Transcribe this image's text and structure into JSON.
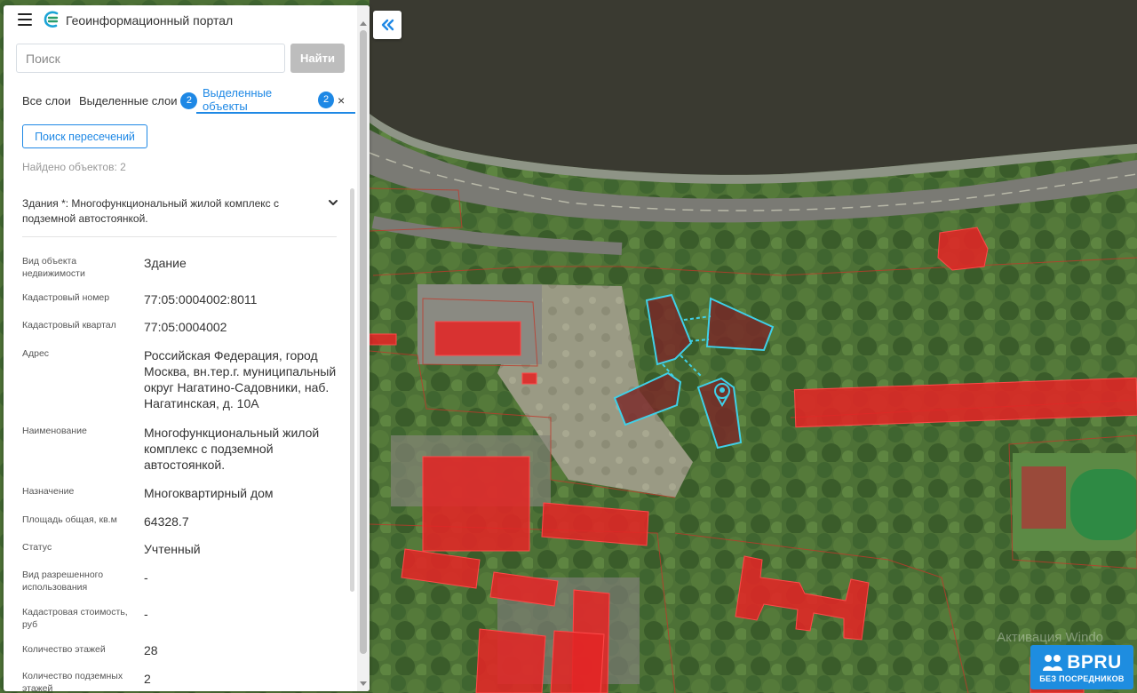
{
  "header": {
    "title": "Геоинформационный портал"
  },
  "search": {
    "placeholder": "Поиск",
    "button_label": "Найти"
  },
  "tabs": [
    {
      "label": "Все слои"
    },
    {
      "label": "Выделенные слои",
      "count": "2"
    },
    {
      "label": "Выделенные объекты",
      "count": "2",
      "active": true
    }
  ],
  "tab_close": "×",
  "intersect_button": "Поиск пересечений",
  "found_text": "Найдено объектов: 2",
  "object": {
    "title": "Здания *: Многофункциональный жилой комплекс с подземной автостоянкой."
  },
  "attributes": [
    {
      "label": "Вид объекта недвижимости",
      "value": "Здание"
    },
    {
      "label": "Кадастровый номер",
      "value": "77:05:0004002:8011"
    },
    {
      "label": "Кадастровый квартал",
      "value": "77:05:0004002"
    },
    {
      "label": "Адрес",
      "value": "Российская Федерация, город Москва, вн.тер.г. муниципальный округ Нагатино-Садовники, наб. Нагатинская, д. 10А"
    },
    {
      "label": "Наименование",
      "value": "Многофункциональный жилой комплекс с подземной автостоянкой."
    },
    {
      "label": "Назначение",
      "value": "Многоквартирный дом"
    },
    {
      "label": "Площадь общая, кв.м",
      "value": "64328.7"
    },
    {
      "label": "Статус",
      "value": "Учтенный"
    },
    {
      "label": "Вид разрешенного использования",
      "value": "-"
    },
    {
      "label": "Кадастровая стоимость, руб",
      "value": "-"
    },
    {
      "label": "Количество этажей",
      "value": "28"
    },
    {
      "label": "Количество подземных этажей",
      "value": "2"
    }
  ],
  "map": {
    "watermark": "Активация Windo",
    "logo_text": "BPRU",
    "logo_subtext": "БЕЗ ПОСРЕДНИКОВ"
  },
  "colors": {
    "accent": "#1e88e5",
    "building_fill": "#e32626",
    "selection_outline": "#3fd0e8",
    "water": "#3a3a31"
  }
}
